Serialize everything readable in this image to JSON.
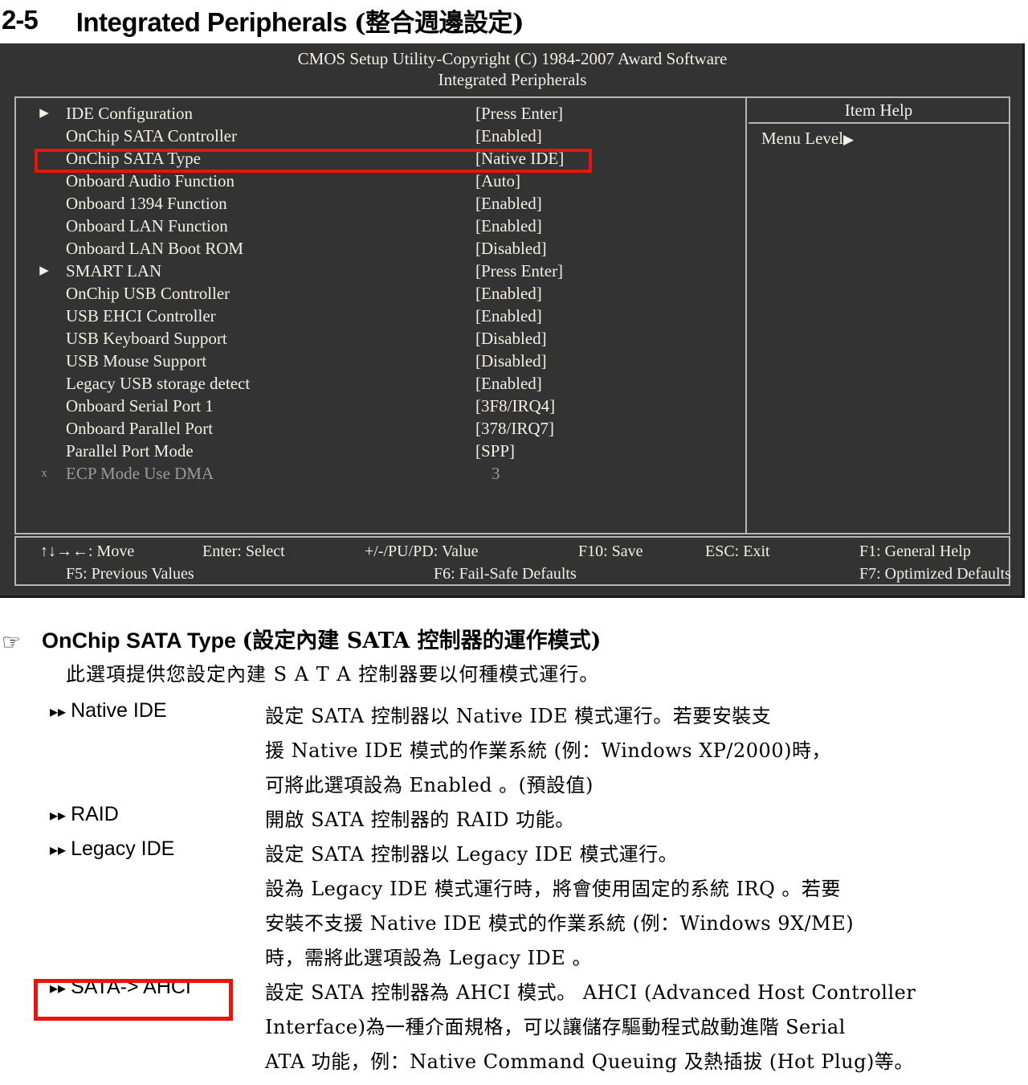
{
  "heading": {
    "section_number": "2-5",
    "title_en": "Integrated Peripherals",
    "title_cn": "(整合週邊設定)"
  },
  "bios": {
    "title_line1": "CMOS Setup Utility-Copyright (C) 1984-2007 Award Software",
    "title_line2": "Integrated Peripherals",
    "help": {
      "title": "Item Help",
      "menu_level_label": "Menu Level",
      "menu_level_arrow": "▶"
    },
    "rows": [
      {
        "marker": "▶",
        "label": "IDE Configuration",
        "value": "[Press Enter]"
      },
      {
        "marker": "",
        "label": "OnChip SATA Controller",
        "value": "[Enabled]"
      },
      {
        "marker": "",
        "label": "OnChip SATA Type",
        "value": "[Native IDE]"
      },
      {
        "marker": "",
        "label": "Onboard Audio Function",
        "value": "[Auto]"
      },
      {
        "marker": "",
        "label": "Onboard 1394 Function",
        "value": "[Enabled]"
      },
      {
        "marker": "",
        "label": "Onboard LAN Function",
        "value": "[Enabled]"
      },
      {
        "marker": "",
        "label": "Onboard LAN Boot ROM",
        "value": "[Disabled]"
      },
      {
        "marker": "▶",
        "label": "SMART LAN",
        "value": "[Press Enter]"
      },
      {
        "marker": "",
        "label": "OnChip USB Controller",
        "value": "[Enabled]"
      },
      {
        "marker": "",
        "label": "USB EHCI Controller",
        "value": "[Enabled]"
      },
      {
        "marker": "",
        "label": "USB Keyboard Support",
        "value": "[Disabled]"
      },
      {
        "marker": "",
        "label": "USB Mouse Support",
        "value": "[Disabled]"
      },
      {
        "marker": "",
        "label": "Legacy USB storage detect",
        "value": "[Enabled]"
      },
      {
        "marker": "",
        "label": "Onboard Serial Port 1",
        "value": "[3F8/IRQ4]"
      },
      {
        "marker": "",
        "label": "Onboard Parallel Port",
        "value": "[378/IRQ7]"
      },
      {
        "marker": "",
        "label": "Parallel Port Mode",
        "value": "[SPP]"
      },
      {
        "marker": "x",
        "label": "ECP Mode Use DMA",
        "value": "3",
        "dim": true
      }
    ],
    "footer": {
      "row1": [
        "↑↓→←: Move",
        "Enter: Select",
        "+/-/PU/PD: Value",
        "F10: Save",
        "ESC: Exit",
        "F1: General Help"
      ],
      "row2": [
        "F5: Previous Values",
        "F6: Fail-Safe Defaults",
        "F7: Optimized Defaults"
      ]
    }
  },
  "explanation": {
    "hand_icon": "☞",
    "option_name": "OnChip SATA Type",
    "option_name_cn": "(設定內建 SATA 控制器的運作模式)",
    "intro": "此選項提供您設定內建 S A T A 控制器要以何種模式運行。",
    "items": [
      {
        "term": "Native IDE",
        "lines": [
          "設定 SATA 控制器以 Native IDE 模式運行。若要安裝支",
          "援 Native IDE 模式的作業系統 (例：Windows XP/2000)時，",
          "可將此選項設為 Enabled 。(預設值)"
        ]
      },
      {
        "term": "RAID",
        "lines": [
          "開啟 SATA 控制器的 RAID 功能。"
        ]
      },
      {
        "term": "Legacy IDE",
        "lines": [
          "設定 SATA 控制器以 Legacy IDE 模式運行。",
          "設為 Legacy IDE 模式運行時，將會使用固定的系統 IRQ 。若要",
          "安裝不支援 Native IDE 模式的作業系統 (例：Windows 9X/ME)",
          "時，需將此選項設為 Legacy IDE 。"
        ]
      },
      {
        "term": "SATA-> AHCI",
        "lines": [
          "設定 SATA 控制器為 AHCI 模式。 AHCI (Advanced Host Controller",
          "Interface)為一種介面規格，可以讓儲存驅動程式啟動進階 Serial",
          "ATA 功能，例：Native Command Queuing 及熱插拔 (Hot Plug)等。"
        ]
      }
    ],
    "bullet": "▸▸"
  },
  "colors": {
    "bios_background": "#333333",
    "bios_text": "#f2efe4",
    "bios_dim_text": "#9a9a9a",
    "bios_border": "#b6b6b6",
    "highlight_red": "#e8140f"
  }
}
